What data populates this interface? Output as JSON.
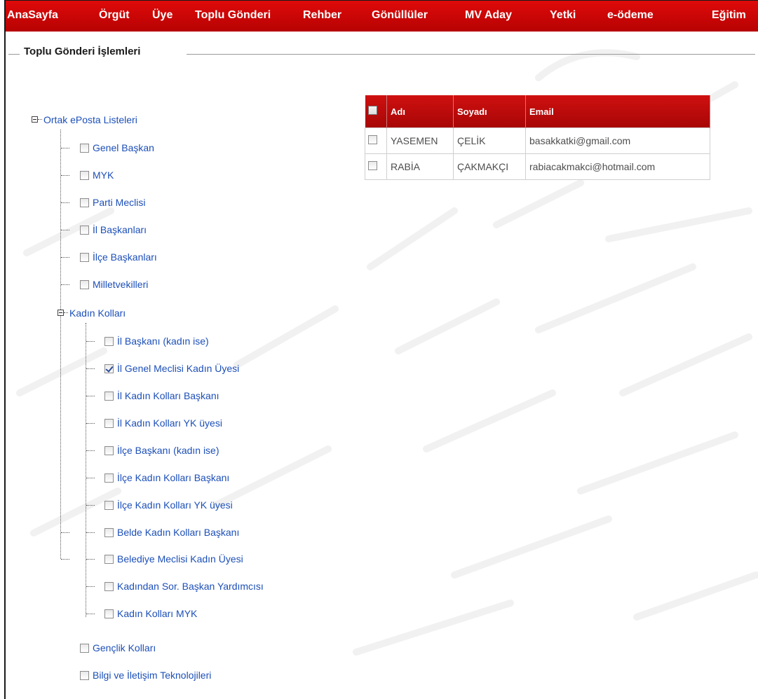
{
  "nav": {
    "items": [
      "AnaSayfa",
      "Örgüt",
      "Üye",
      "Toplu Gönderi",
      "Rehber",
      "Gönüllüler",
      "MV Aday",
      "Yetki",
      "e-ödeme",
      "Eğitim"
    ]
  },
  "section": {
    "title": "Toplu Gönderi İşlemleri"
  },
  "tree": {
    "root": "Ortak ePosta Listeleri",
    "items": [
      "Genel Başkan",
      "MYK",
      "Parti Meclisi",
      "İl Başkanları",
      "İlçe Başkanları",
      "Milletvekilleri"
    ],
    "group": "Kadın Kolları",
    "group_items": [
      "İl Başkanı (kadın ise)",
      "İl Genel Meclisi Kadın Üyesi",
      "İl Kadın Kolları Başkanı",
      "İl Kadın Kolları YK üyesi",
      "İlçe Başkanı (kadın ise)",
      "İlçe Kadın Kolları Başkanı",
      "İlçe Kadın Kolları YK üyesi",
      "Belde Kadın Kolları Başkanı",
      "Belediye Meclisi Kadın Üyesi",
      "Kadından Sor. Başkan Yardımcısı",
      "Kadın Kolları MYK"
    ],
    "tail_items": [
      "Gençlik Kolları",
      "Bilgi ve İletişim Teknolojileri"
    ],
    "checked_item": "İl Genel Meclisi Kadın Üyesi"
  },
  "table": {
    "headers": {
      "name": "Adı",
      "surname": "Soyadı",
      "email": "Email"
    },
    "rows": [
      {
        "name": "YASEMEN",
        "surname": "ÇELİK",
        "email": "basakkatki@gmail.com"
      },
      {
        "name": "RABİA",
        "surname": "ÇAKMAKÇI",
        "email": "rabiacakmakci@hotmail.com"
      }
    ]
  },
  "colors": {
    "nav_red": "#c80606",
    "link_blue": "#1c4fb8"
  }
}
